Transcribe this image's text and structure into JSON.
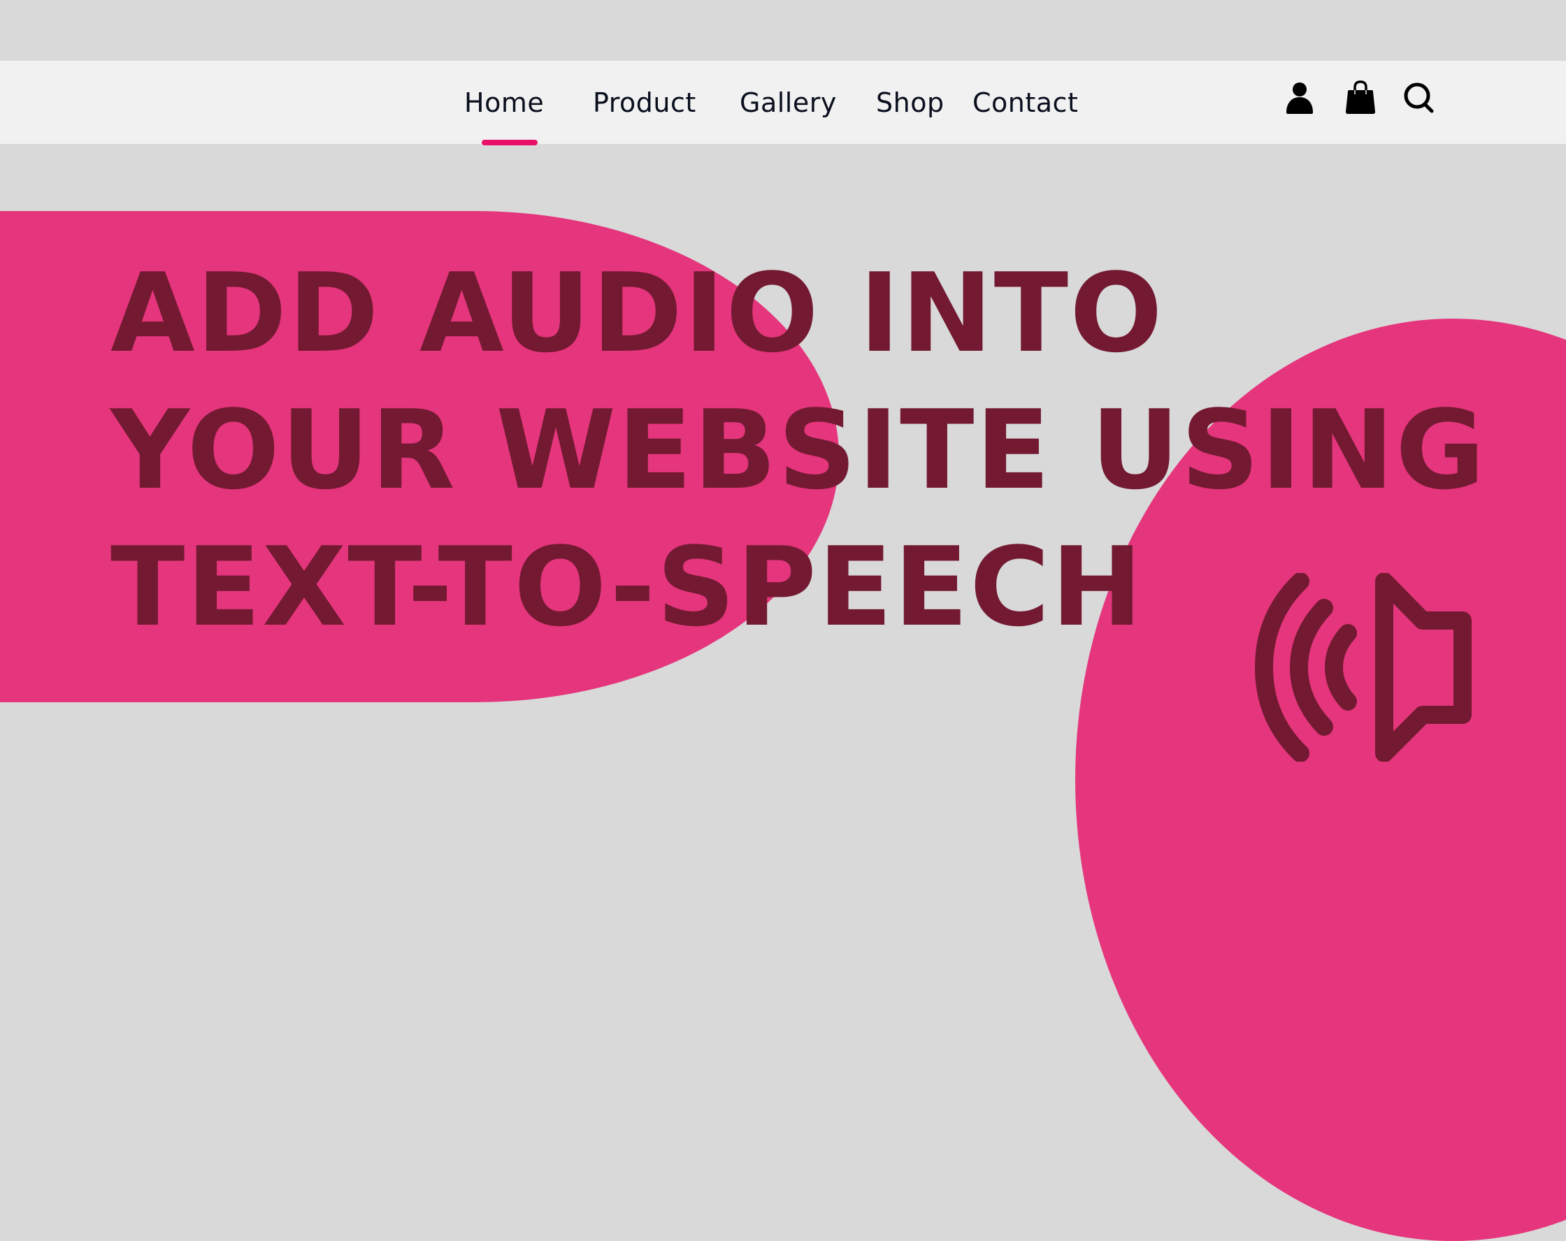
{
  "nav": {
    "links": [
      {
        "label": "Home",
        "active": true
      },
      {
        "label": "Product",
        "active": false
      },
      {
        "label": "Gallery",
        "active": false
      },
      {
        "label": "Shop",
        "active": false
      },
      {
        "label": "Contact",
        "active": false
      }
    ],
    "icons": [
      "user-icon",
      "shopping-bag-icon",
      "search-icon"
    ],
    "active_color": "#ea1069"
  },
  "hero": {
    "title_lines": [
      "ADD AUDIO INTO",
      "YOUR WEBSITE USING",
      "TEXT-TO-SPEECH"
    ],
    "icon": "speaker-volume-icon"
  },
  "colors": {
    "background": "#d9d9d9",
    "navbar": "#f1f1f1",
    "accent_pink": "#e5357c",
    "title_text": "#731a32"
  }
}
